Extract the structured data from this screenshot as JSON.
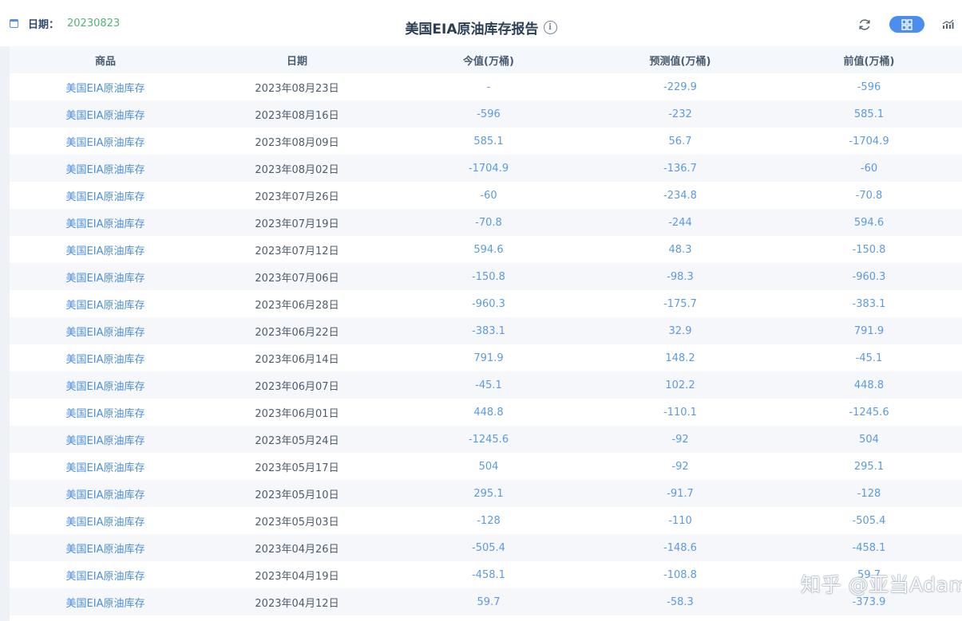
{
  "header": {
    "date_label": "日期：",
    "date_value": "20230823",
    "title": "美国EIA原油库存报告",
    "info_symbol": "i",
    "icons": {
      "calendar": "calendar-icon",
      "info": "info-icon",
      "refresh": "refresh-icon",
      "grid": "grid-view-icon",
      "chart": "chart-view-icon"
    },
    "colors": {
      "accent": "#4a8ff0",
      "date_value": "#55b37a",
      "title": "#2b3e55"
    }
  },
  "table": {
    "columns": [
      "商品",
      "日期",
      "今值(万桶)",
      "预测值(万桶)",
      "前值(万桶)"
    ],
    "rows": [
      [
        "美国EIA原油库存",
        "2023年08月23日",
        "-",
        "-229.9",
        "-596"
      ],
      [
        "美国EIA原油库存",
        "2023年08月16日",
        "-596",
        "-232",
        "585.1"
      ],
      [
        "美国EIA原油库存",
        "2023年08月09日",
        "585.1",
        "56.7",
        "-1704.9"
      ],
      [
        "美国EIA原油库存",
        "2023年08月02日",
        "-1704.9",
        "-136.7",
        "-60"
      ],
      [
        "美国EIA原油库存",
        "2023年07月26日",
        "-60",
        "-234.8",
        "-70.8"
      ],
      [
        "美国EIA原油库存",
        "2023年07月19日",
        "-70.8",
        "-244",
        "594.6"
      ],
      [
        "美国EIA原油库存",
        "2023年07月12日",
        "594.6",
        "48.3",
        "-150.8"
      ],
      [
        "美国EIA原油库存",
        "2023年07月06日",
        "-150.8",
        "-98.3",
        "-960.3"
      ],
      [
        "美国EIA原油库存",
        "2023年06月28日",
        "-960.3",
        "-175.7",
        "-383.1"
      ],
      [
        "美国EIA原油库存",
        "2023年06月22日",
        "-383.1",
        "32.9",
        "791.9"
      ],
      [
        "美国EIA原油库存",
        "2023年06月14日",
        "791.9",
        "148.2",
        "-45.1"
      ],
      [
        "美国EIA原油库存",
        "2023年06月07日",
        "-45.1",
        "102.2",
        "448.8"
      ],
      [
        "美国EIA原油库存",
        "2023年06月01日",
        "448.8",
        "-110.1",
        "-1245.6"
      ],
      [
        "美国EIA原油库存",
        "2023年05月24日",
        "-1245.6",
        "-92",
        "504"
      ],
      [
        "美国EIA原油库存",
        "2023年05月17日",
        "504",
        "-92",
        "295.1"
      ],
      [
        "美国EIA原油库存",
        "2023年05月10日",
        "295.1",
        "-91.7",
        "-128"
      ],
      [
        "美国EIA原油库存",
        "2023年05月03日",
        "-128",
        "-110",
        "-505.4"
      ],
      [
        "美国EIA原油库存",
        "2023年04月26日",
        "-505.4",
        "-148.6",
        "-458.1"
      ],
      [
        "美国EIA原油库存",
        "2023年04月19日",
        "-458.1",
        "-108.8",
        "59.7"
      ],
      [
        "美国EIA原油库存",
        "2023年04月12日",
        "59.7",
        "-58.3",
        "-373.9"
      ]
    ]
  },
  "watermark": {
    "text": "知乎 @亚当Adam"
  }
}
